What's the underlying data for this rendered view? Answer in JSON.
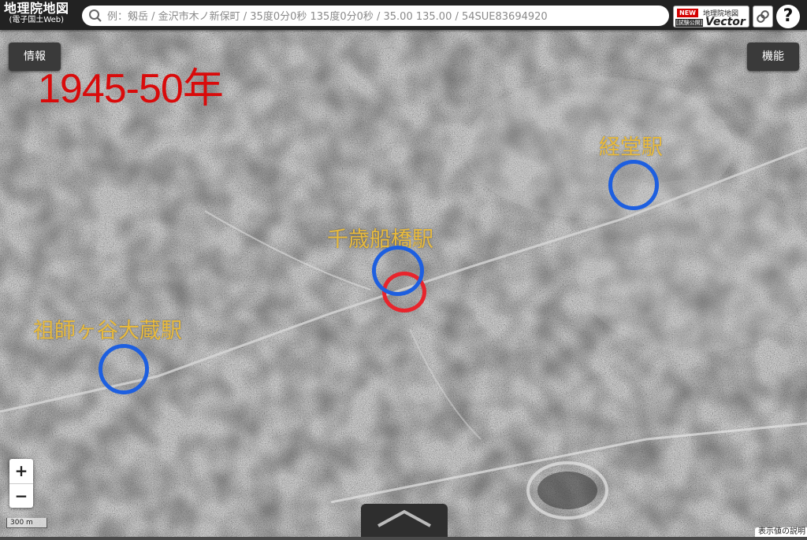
{
  "app": {
    "logo_title": "地理院地図",
    "logo_subtitle": "(電子国土Web)"
  },
  "search": {
    "placeholder": "例：剱岳 / 金沢市木ノ新保町 / 35度0分0秒 135度0分0秒 / 35.00 135.00 / 54SUE83694920"
  },
  "vector_button": {
    "new_badge": "NEW",
    "gsi_label": "地理院地図",
    "trial_label": "[試験公開]",
    "vector_label": "Vector"
  },
  "help_label": "?",
  "info_button_label": "情報",
  "function_button_label": "機能",
  "overlay": {
    "year_label": "1945-50年",
    "stations": [
      {
        "name": "経堂駅",
        "marker": "blue"
      },
      {
        "name": "千歳船橋駅",
        "marker": "blue"
      },
      {
        "name": "祖師ヶ谷大蔵駅",
        "marker": "blue"
      }
    ],
    "marker_colors": {
      "blue": "#1d5fe0",
      "red": "#e8242c",
      "label": "#e8ba3c",
      "year": "#d90b0b"
    }
  },
  "zoom": {
    "in_label": "+",
    "out_label": "−"
  },
  "scale_label": "300 m",
  "legend_note": "表示値の説明"
}
